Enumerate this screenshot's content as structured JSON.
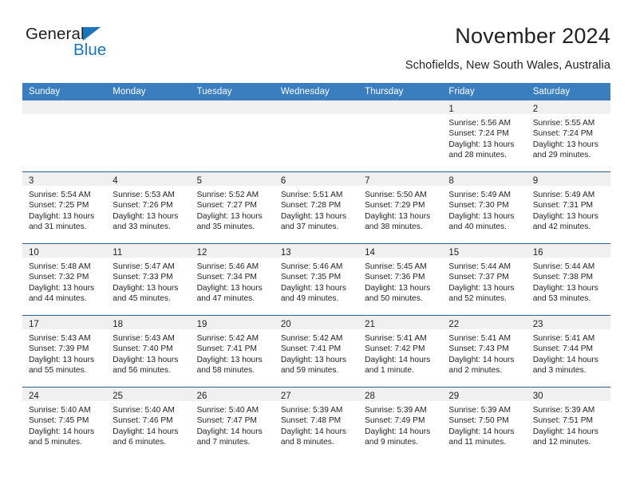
{
  "brand": {
    "word1": "General",
    "word2": "Blue",
    "triangle_icon": "blue-triangle-icon",
    "accent_color": "#1b75bb"
  },
  "header": {
    "title": "November 2024",
    "subtitle": "Schofields, New South Wales, Australia"
  },
  "colors": {
    "header_blue": "#3a7ebf",
    "row_divider": "#2e5f8a",
    "daynum_band": "#f0f0f0",
    "text": "#231f20"
  },
  "weekdays": [
    "Sunday",
    "Monday",
    "Tuesday",
    "Wednesday",
    "Thursday",
    "Friday",
    "Saturday"
  ],
  "weeks": [
    [
      {
        "day": "",
        "sunrise": "",
        "sunset": "",
        "daylight1": "",
        "daylight2": ""
      },
      {
        "day": "",
        "sunrise": "",
        "sunset": "",
        "daylight1": "",
        "daylight2": ""
      },
      {
        "day": "",
        "sunrise": "",
        "sunset": "",
        "daylight1": "",
        "daylight2": ""
      },
      {
        "day": "",
        "sunrise": "",
        "sunset": "",
        "daylight1": "",
        "daylight2": ""
      },
      {
        "day": "",
        "sunrise": "",
        "sunset": "",
        "daylight1": "",
        "daylight2": ""
      },
      {
        "day": "1",
        "sunrise": "Sunrise: 5:56 AM",
        "sunset": "Sunset: 7:24 PM",
        "daylight1": "Daylight: 13 hours",
        "daylight2": "and 28 minutes."
      },
      {
        "day": "2",
        "sunrise": "Sunrise: 5:55 AM",
        "sunset": "Sunset: 7:24 PM",
        "daylight1": "Daylight: 13 hours",
        "daylight2": "and 29 minutes."
      }
    ],
    [
      {
        "day": "3",
        "sunrise": "Sunrise: 5:54 AM",
        "sunset": "Sunset: 7:25 PM",
        "daylight1": "Daylight: 13 hours",
        "daylight2": "and 31 minutes."
      },
      {
        "day": "4",
        "sunrise": "Sunrise: 5:53 AM",
        "sunset": "Sunset: 7:26 PM",
        "daylight1": "Daylight: 13 hours",
        "daylight2": "and 33 minutes."
      },
      {
        "day": "5",
        "sunrise": "Sunrise: 5:52 AM",
        "sunset": "Sunset: 7:27 PM",
        "daylight1": "Daylight: 13 hours",
        "daylight2": "and 35 minutes."
      },
      {
        "day": "6",
        "sunrise": "Sunrise: 5:51 AM",
        "sunset": "Sunset: 7:28 PM",
        "daylight1": "Daylight: 13 hours",
        "daylight2": "and 37 minutes."
      },
      {
        "day": "7",
        "sunrise": "Sunrise: 5:50 AM",
        "sunset": "Sunset: 7:29 PM",
        "daylight1": "Daylight: 13 hours",
        "daylight2": "and 38 minutes."
      },
      {
        "day": "8",
        "sunrise": "Sunrise: 5:49 AM",
        "sunset": "Sunset: 7:30 PM",
        "daylight1": "Daylight: 13 hours",
        "daylight2": "and 40 minutes."
      },
      {
        "day": "9",
        "sunrise": "Sunrise: 5:49 AM",
        "sunset": "Sunset: 7:31 PM",
        "daylight1": "Daylight: 13 hours",
        "daylight2": "and 42 minutes."
      }
    ],
    [
      {
        "day": "10",
        "sunrise": "Sunrise: 5:48 AM",
        "sunset": "Sunset: 7:32 PM",
        "daylight1": "Daylight: 13 hours",
        "daylight2": "and 44 minutes."
      },
      {
        "day": "11",
        "sunrise": "Sunrise: 5:47 AM",
        "sunset": "Sunset: 7:33 PM",
        "daylight1": "Daylight: 13 hours",
        "daylight2": "and 45 minutes."
      },
      {
        "day": "12",
        "sunrise": "Sunrise: 5:46 AM",
        "sunset": "Sunset: 7:34 PM",
        "daylight1": "Daylight: 13 hours",
        "daylight2": "and 47 minutes."
      },
      {
        "day": "13",
        "sunrise": "Sunrise: 5:46 AM",
        "sunset": "Sunset: 7:35 PM",
        "daylight1": "Daylight: 13 hours",
        "daylight2": "and 49 minutes."
      },
      {
        "day": "14",
        "sunrise": "Sunrise: 5:45 AM",
        "sunset": "Sunset: 7:36 PM",
        "daylight1": "Daylight: 13 hours",
        "daylight2": "and 50 minutes."
      },
      {
        "day": "15",
        "sunrise": "Sunrise: 5:44 AM",
        "sunset": "Sunset: 7:37 PM",
        "daylight1": "Daylight: 13 hours",
        "daylight2": "and 52 minutes."
      },
      {
        "day": "16",
        "sunrise": "Sunrise: 5:44 AM",
        "sunset": "Sunset: 7:38 PM",
        "daylight1": "Daylight: 13 hours",
        "daylight2": "and 53 minutes."
      }
    ],
    [
      {
        "day": "17",
        "sunrise": "Sunrise: 5:43 AM",
        "sunset": "Sunset: 7:39 PM",
        "daylight1": "Daylight: 13 hours",
        "daylight2": "and 55 minutes."
      },
      {
        "day": "18",
        "sunrise": "Sunrise: 5:43 AM",
        "sunset": "Sunset: 7:40 PM",
        "daylight1": "Daylight: 13 hours",
        "daylight2": "and 56 minutes."
      },
      {
        "day": "19",
        "sunrise": "Sunrise: 5:42 AM",
        "sunset": "Sunset: 7:41 PM",
        "daylight1": "Daylight: 13 hours",
        "daylight2": "and 58 minutes."
      },
      {
        "day": "20",
        "sunrise": "Sunrise: 5:42 AM",
        "sunset": "Sunset: 7:41 PM",
        "daylight1": "Daylight: 13 hours",
        "daylight2": "and 59 minutes."
      },
      {
        "day": "21",
        "sunrise": "Sunrise: 5:41 AM",
        "sunset": "Sunset: 7:42 PM",
        "daylight1": "Daylight: 14 hours",
        "daylight2": "and 1 minute."
      },
      {
        "day": "22",
        "sunrise": "Sunrise: 5:41 AM",
        "sunset": "Sunset: 7:43 PM",
        "daylight1": "Daylight: 14 hours",
        "daylight2": "and 2 minutes."
      },
      {
        "day": "23",
        "sunrise": "Sunrise: 5:41 AM",
        "sunset": "Sunset: 7:44 PM",
        "daylight1": "Daylight: 14 hours",
        "daylight2": "and 3 minutes."
      }
    ],
    [
      {
        "day": "24",
        "sunrise": "Sunrise: 5:40 AM",
        "sunset": "Sunset: 7:45 PM",
        "daylight1": "Daylight: 14 hours",
        "daylight2": "and 5 minutes."
      },
      {
        "day": "25",
        "sunrise": "Sunrise: 5:40 AM",
        "sunset": "Sunset: 7:46 PM",
        "daylight1": "Daylight: 14 hours",
        "daylight2": "and 6 minutes."
      },
      {
        "day": "26",
        "sunrise": "Sunrise: 5:40 AM",
        "sunset": "Sunset: 7:47 PM",
        "daylight1": "Daylight: 14 hours",
        "daylight2": "and 7 minutes."
      },
      {
        "day": "27",
        "sunrise": "Sunrise: 5:39 AM",
        "sunset": "Sunset: 7:48 PM",
        "daylight1": "Daylight: 14 hours",
        "daylight2": "and 8 minutes."
      },
      {
        "day": "28",
        "sunrise": "Sunrise: 5:39 AM",
        "sunset": "Sunset: 7:49 PM",
        "daylight1": "Daylight: 14 hours",
        "daylight2": "and 9 minutes."
      },
      {
        "day": "29",
        "sunrise": "Sunrise: 5:39 AM",
        "sunset": "Sunset: 7:50 PM",
        "daylight1": "Daylight: 14 hours",
        "daylight2": "and 11 minutes."
      },
      {
        "day": "30",
        "sunrise": "Sunrise: 5:39 AM",
        "sunset": "Sunset: 7:51 PM",
        "daylight1": "Daylight: 14 hours",
        "daylight2": "and 12 minutes."
      }
    ]
  ]
}
